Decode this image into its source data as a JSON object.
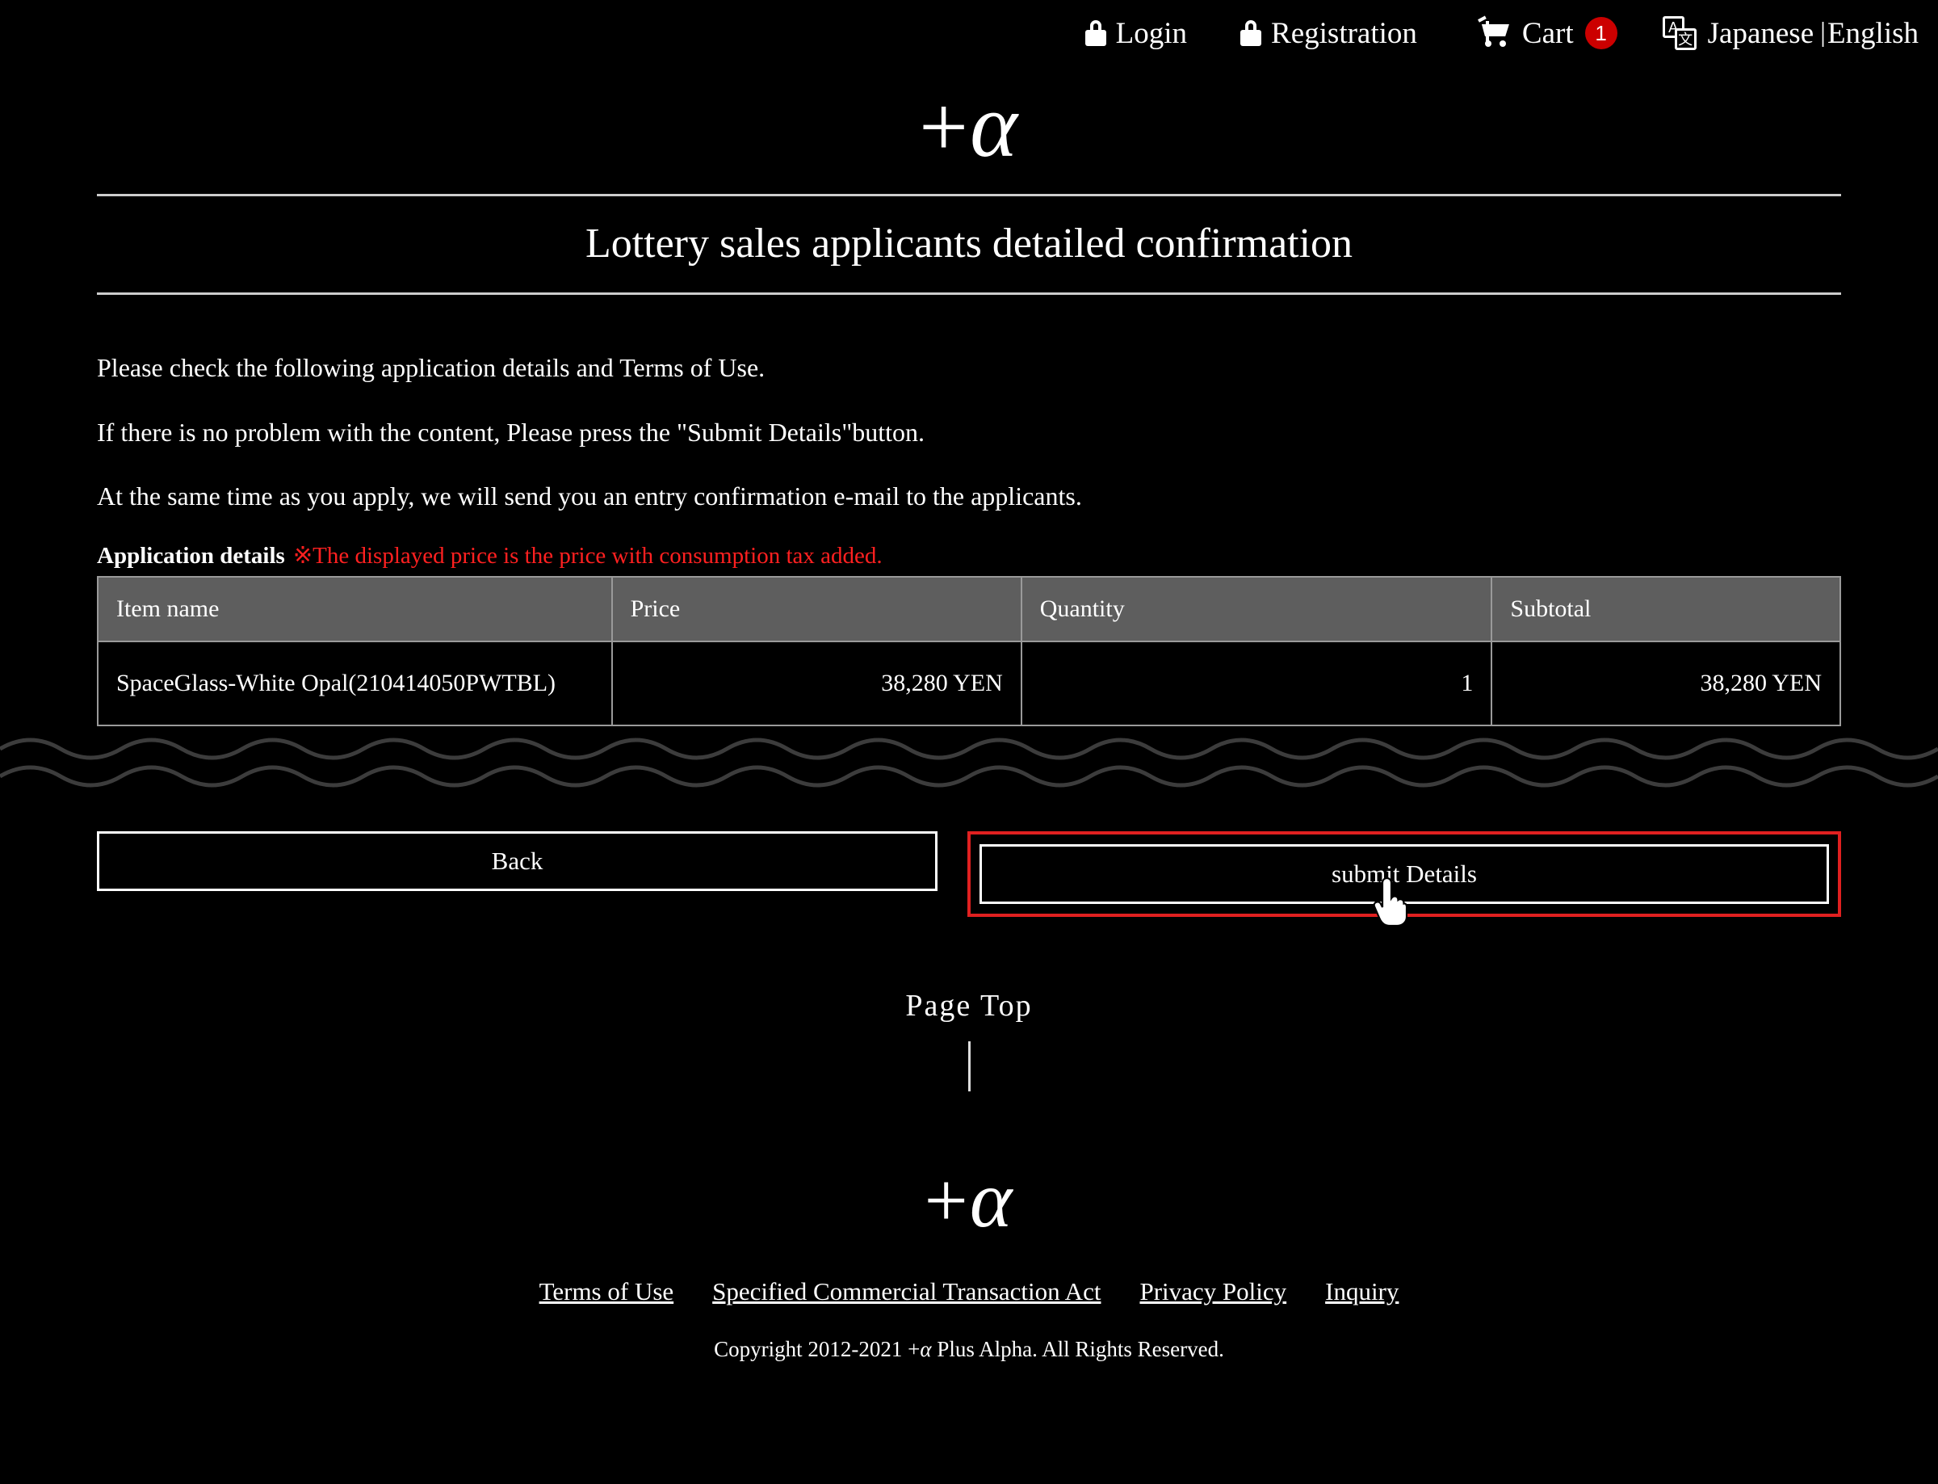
{
  "theme": {
    "background": "#000000",
    "text": "#ffffff",
    "accent_red": "#cc0000",
    "highlight_red": "#e02020",
    "warning_red": "#ff2020",
    "table_header_bg": "#5e5e5e",
    "rule_gray": "#cccccc",
    "border_gray": "#9a9a9a"
  },
  "topnav": {
    "login": {
      "label": "Login",
      "icon": "lock-icon"
    },
    "registration": {
      "label": "Registration",
      "icon": "lock-icon"
    },
    "cart": {
      "label": "Cart",
      "icon": "cart-icon",
      "count": "1"
    },
    "language": {
      "icon": "translate-icon",
      "icon_glyph_a": "A",
      "icon_glyph_b": "文",
      "japanese": "Japanese",
      "separator": "|",
      "english": "English"
    }
  },
  "brand": {
    "plus": "+",
    "alpha": "α",
    "full": "+α"
  },
  "page": {
    "title": "Lottery sales applicants detailed confirmation"
  },
  "lead": {
    "line1": "Please check the following application details and Terms of Use.",
    "line2": "If there is no problem with the content, Please press the \"Submit Details\"button.",
    "line3": "At the same time as you apply, we will send you an entry confirmation e-mail to the applicants."
  },
  "application_details": {
    "label": "Application details",
    "tax_note": "※The displayed price is the price with consumption tax added."
  },
  "items_table": {
    "columns": [
      "Item name",
      "Price",
      "Quantity",
      "Subtotal"
    ],
    "rows": [
      {
        "item_name": "SpaceGlass-White Opal(210414050PWTBL)",
        "price": "38,280 YEN",
        "quantity": "1",
        "subtotal": "38,280 YEN"
      }
    ]
  },
  "buttons": {
    "back": "Back",
    "submit": "submit Details"
  },
  "cursor": {
    "icon": "pointing-hand-cursor"
  },
  "pagetop": {
    "label": "Page Top"
  },
  "footer": {
    "links": [
      "Terms of Use",
      "Specified Commercial Transaction Act",
      "Privacy Policy",
      "Inquiry"
    ],
    "copyright_prefix": "Copyright 2012-2021 +",
    "copyright_alpha": "α",
    "copyright_suffix": " Plus Alpha. All Rights Reserved."
  }
}
